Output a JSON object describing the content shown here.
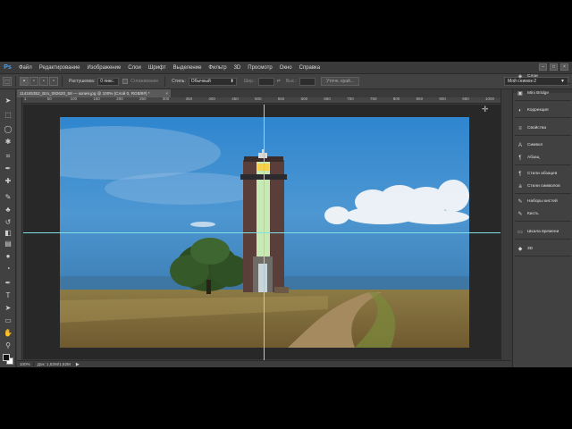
{
  "app": {
    "logo": "Ps"
  },
  "menubar": {
    "items": [
      "Файл",
      "Редактирование",
      "Изображение",
      "Слои",
      "Шрифт",
      "Выделение",
      "Фильтр",
      "3D",
      "Просмотр",
      "Окно",
      "Справка"
    ],
    "window_controls": [
      "–",
      "□",
      "×"
    ]
  },
  "options_bar": {
    "feather_label": "Растушевка:",
    "feather_value": "0 пикс.",
    "antialias_label": "Сглаживание",
    "style_label": "Стиль:",
    "style_value": "Обычный",
    "width_label": "Шир.:",
    "height_label": "Выс.:",
    "swap_icon": "⇄",
    "refine_button": "Уточн. край...",
    "workspace": "Мой снимок-2"
  },
  "document": {
    "tab_title": "114245352_Bzo_082620_58 — копия.jpg @ 100% (Слой 0, RGB/8#) *",
    "tab_close": "×",
    "zoom": "100%",
    "doc_info": "Док: 1,52M/1,52M",
    "status_arrow": "▶",
    "cursor_icon": "✛"
  },
  "ruler": {
    "h_ticks": [
      "1",
      "50",
      "100",
      "150",
      "200",
      "250",
      "300",
      "350",
      "400",
      "450",
      "500",
      "550",
      "600",
      "650",
      "700",
      "750",
      "800",
      "850",
      "900",
      "950",
      "1000"
    ]
  },
  "panels": [
    {
      "label": "Слои",
      "icon": "layers-icon",
      "glyph": "◈"
    },
    {
      "label": "Mini Bridge",
      "icon": "bridge-icon",
      "glyph": "▣"
    },
    {
      "label": "Коррекция",
      "icon": "adjustments-icon",
      "glyph": "◐"
    },
    {
      "label": "Свойства",
      "icon": "properties-icon",
      "glyph": "≡"
    },
    {
      "label": "Символ",
      "icon": "character-icon",
      "glyph": "A"
    },
    {
      "label": "Абзац",
      "icon": "paragraph-icon",
      "glyph": "¶"
    },
    {
      "label": "Стили абзацев",
      "icon": "paragraph-styles-icon",
      "glyph": "¶"
    },
    {
      "label": "Стили символов",
      "icon": "character-styles-icon",
      "glyph": "a"
    },
    {
      "label": "Наборы кистей",
      "icon": "brush-presets-icon",
      "glyph": "✎"
    },
    {
      "label": "Кисть",
      "icon": "brush-icon",
      "glyph": "✎"
    },
    {
      "label": "Шкала времени",
      "icon": "timeline-icon",
      "glyph": "▭"
    },
    {
      "label": "3D",
      "icon": "3d-icon",
      "glyph": "◆"
    }
  ],
  "tools": [
    {
      "name": "move-tool-icon",
      "glyph": "➤"
    },
    {
      "name": "marquee-tool-icon",
      "glyph": "⬚"
    },
    {
      "name": "lasso-tool-icon",
      "glyph": "◯"
    },
    {
      "name": "quick-select-tool-icon",
      "glyph": "✱"
    },
    {
      "name": "crop-tool-icon",
      "glyph": "⌗"
    },
    {
      "name": "eyedropper-tool-icon",
      "glyph": "✒"
    },
    {
      "name": "healing-brush-icon",
      "glyph": "✚"
    },
    {
      "name": "brush-tool-icon",
      "glyph": "✎"
    },
    {
      "name": "clone-stamp-icon",
      "glyph": "♣"
    },
    {
      "name": "history-brush-icon",
      "glyph": "↺"
    },
    {
      "name": "eraser-tool-icon",
      "glyph": "◧"
    },
    {
      "name": "gradient-tool-icon",
      "glyph": "▤"
    },
    {
      "name": "blur-tool-icon",
      "glyph": "●"
    },
    {
      "name": "dodge-tool-icon",
      "glyph": "◔"
    },
    {
      "name": "pen-tool-icon",
      "glyph": "✒"
    },
    {
      "name": "type-tool-icon",
      "glyph": "T"
    },
    {
      "name": "path-select-tool-icon",
      "glyph": "➤"
    },
    {
      "name": "shape-tool-icon",
      "glyph": "▭"
    },
    {
      "name": "hand-tool-icon",
      "glyph": "✋"
    },
    {
      "name": "zoom-tool-icon",
      "glyph": "⚲"
    }
  ],
  "colors": {
    "guide": "#7fe0e6",
    "accent": "#3fa4ff"
  }
}
